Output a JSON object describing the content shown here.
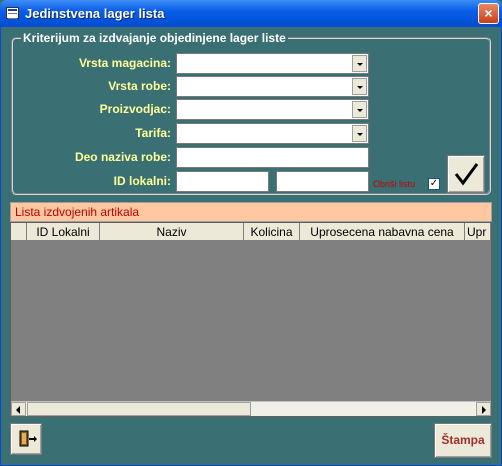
{
  "window": {
    "title": "Jedinstvena lager lista",
    "close_glyph": "×"
  },
  "criteria": {
    "legend": "Kriterijum za izdvajanje objedinjene lager liste",
    "vrsta_magacina": {
      "label": "Vrsta magacina:",
      "value": ""
    },
    "vrsta_robe": {
      "label": "Vrsta robe:",
      "value": ""
    },
    "proizvodjac": {
      "label": "Proizvodjac:",
      "value": ""
    },
    "tarifa": {
      "label": "Tarifa:",
      "value": ""
    },
    "deo_naziva": {
      "label": "Deo naziva robe:",
      "value": ""
    },
    "id_lokalni": {
      "label": "ID lokalni:",
      "from": "",
      "to": ""
    },
    "obrisi_listu": {
      "label": "Obriši listu",
      "checked": true,
      "glyph": "✓"
    }
  },
  "list": {
    "title": "Lista izdvojenih artikala",
    "columns": [
      "",
      "ID Lokalni",
      "Naziv",
      "Kolicina",
      "Uprosecena nabavna cena",
      "Upr"
    ]
  },
  "buttons": {
    "print_label": "Štampa"
  },
  "icons": {
    "app": "form-icon",
    "ok": "checkmark-icon",
    "exit": "exit-door-icon"
  },
  "colors": {
    "background": "#3a7073",
    "label_yellow": "#ffff99",
    "list_header_bg": "#ffc8a0",
    "red_text": "#c00000"
  }
}
